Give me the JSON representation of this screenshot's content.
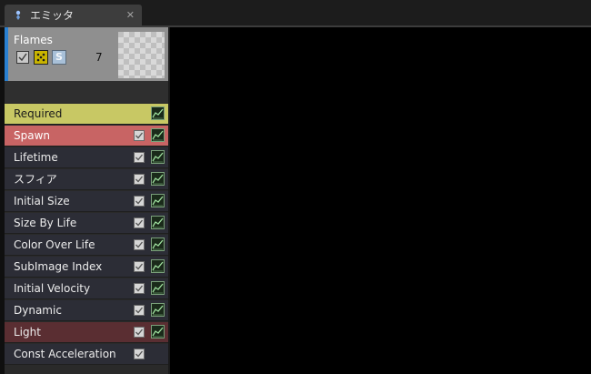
{
  "tab": {
    "title": "エミッタ",
    "close_glyph": "✕",
    "icon": "emitter-icon"
  },
  "emitter": {
    "name": "Flames",
    "particle_count": "7",
    "solo_label": "S",
    "accent_color": "#2a80d0"
  },
  "modules": [
    {
      "label": "Required",
      "type": "required",
      "checkbox": false,
      "curve": true
    },
    {
      "label": "Spawn",
      "type": "spawn",
      "checkbox": true,
      "curve": true
    },
    {
      "label": "Lifetime",
      "type": "normal",
      "checkbox": true,
      "curve": true
    },
    {
      "label": "スフィア",
      "type": "normal",
      "checkbox": true,
      "curve": true
    },
    {
      "label": "Initial Size",
      "type": "normal",
      "checkbox": true,
      "curve": true
    },
    {
      "label": "Size By Life",
      "type": "normal",
      "checkbox": true,
      "curve": true
    },
    {
      "label": "Color Over Life",
      "type": "normal",
      "checkbox": true,
      "curve": true
    },
    {
      "label": "SubImage Index",
      "type": "normal",
      "checkbox": true,
      "curve": true
    },
    {
      "label": "Initial Velocity",
      "type": "normal",
      "checkbox": true,
      "curve": true
    },
    {
      "label": "Dynamic",
      "type": "normal",
      "checkbox": true,
      "curve": true
    },
    {
      "label": "Light",
      "type": "light",
      "checkbox": true,
      "curve": true
    },
    {
      "label": "Const Acceleration",
      "type": "normal",
      "checkbox": true,
      "curve": false
    }
  ],
  "colors": {
    "required": "#c8c864",
    "spawn": "#c86464",
    "light": "#5a2e32",
    "normal": "#2c2d36",
    "viewport": "#000000"
  }
}
